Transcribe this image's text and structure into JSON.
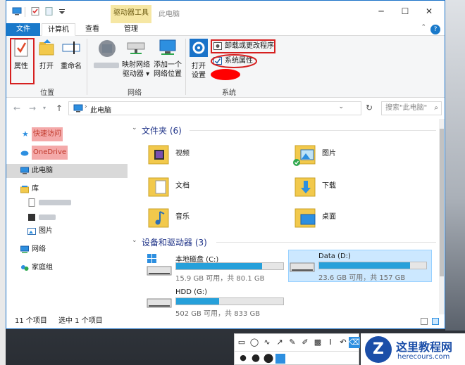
{
  "titlebar": {
    "context_tab": "驱动器工具",
    "title": "此电脑",
    "minimize": "─",
    "maximize": "☐",
    "close": "✕"
  },
  "tabs": {
    "file": "文件",
    "computer": "计算机",
    "view": "查看",
    "manage": "管理"
  },
  "ribbon": {
    "location": {
      "properties": "属性",
      "open": "打开",
      "rename": "重命名",
      "group": "位置"
    },
    "network": {
      "map_drive_line1": "映射网络",
      "map_drive_line2": "驱动器 ▾",
      "add_location_line1": "添加一个",
      "add_location_line2": "网络位置",
      "group": "网络"
    },
    "system": {
      "open_settings_line1": "打开",
      "open_settings_line2": "设置",
      "uninstall": "卸载或更改程序",
      "system_properties": "系统属性",
      "group": "系统"
    }
  },
  "address": {
    "path": "此电脑",
    "search_placeholder": "搜索\"此电脑\""
  },
  "nav": {
    "quick_access": "快速访问",
    "onedrive": "OneDrive",
    "this_pc": "此电脑",
    "libraries": "库",
    "pictures": "图片",
    "network": "网络",
    "homegroup": "家庭组"
  },
  "folders": {
    "title": "文件夹 (6)",
    "items": [
      "视频",
      "图片",
      "文档",
      "下载",
      "音乐",
      "桌面"
    ]
  },
  "drives": {
    "title": "设备和驱动器 (3)",
    "items": [
      {
        "name": "本地磁盘 (C:)",
        "size": "15.9 GB 可用，共 80.1 GB",
        "used_fraction": 0.8
      },
      {
        "name": "Data (D:)",
        "size": "23.6 GB 可用，共 157 GB",
        "used_fraction": 0.85
      },
      {
        "name": "HDD (G:)",
        "size": "502 GB 可用，共 833 GB",
        "used_fraction": 0.4
      }
    ]
  },
  "status": {
    "count": "11 个项目",
    "selected": "选中 1 个项目"
  },
  "watermark": {
    "logo": "Z",
    "name": "这里教程网",
    "url": "herecours.com"
  },
  "colors": {
    "accent": "#1979ca",
    "drive_bar": "#26a0da",
    "highlight_red": "#d62020"
  }
}
